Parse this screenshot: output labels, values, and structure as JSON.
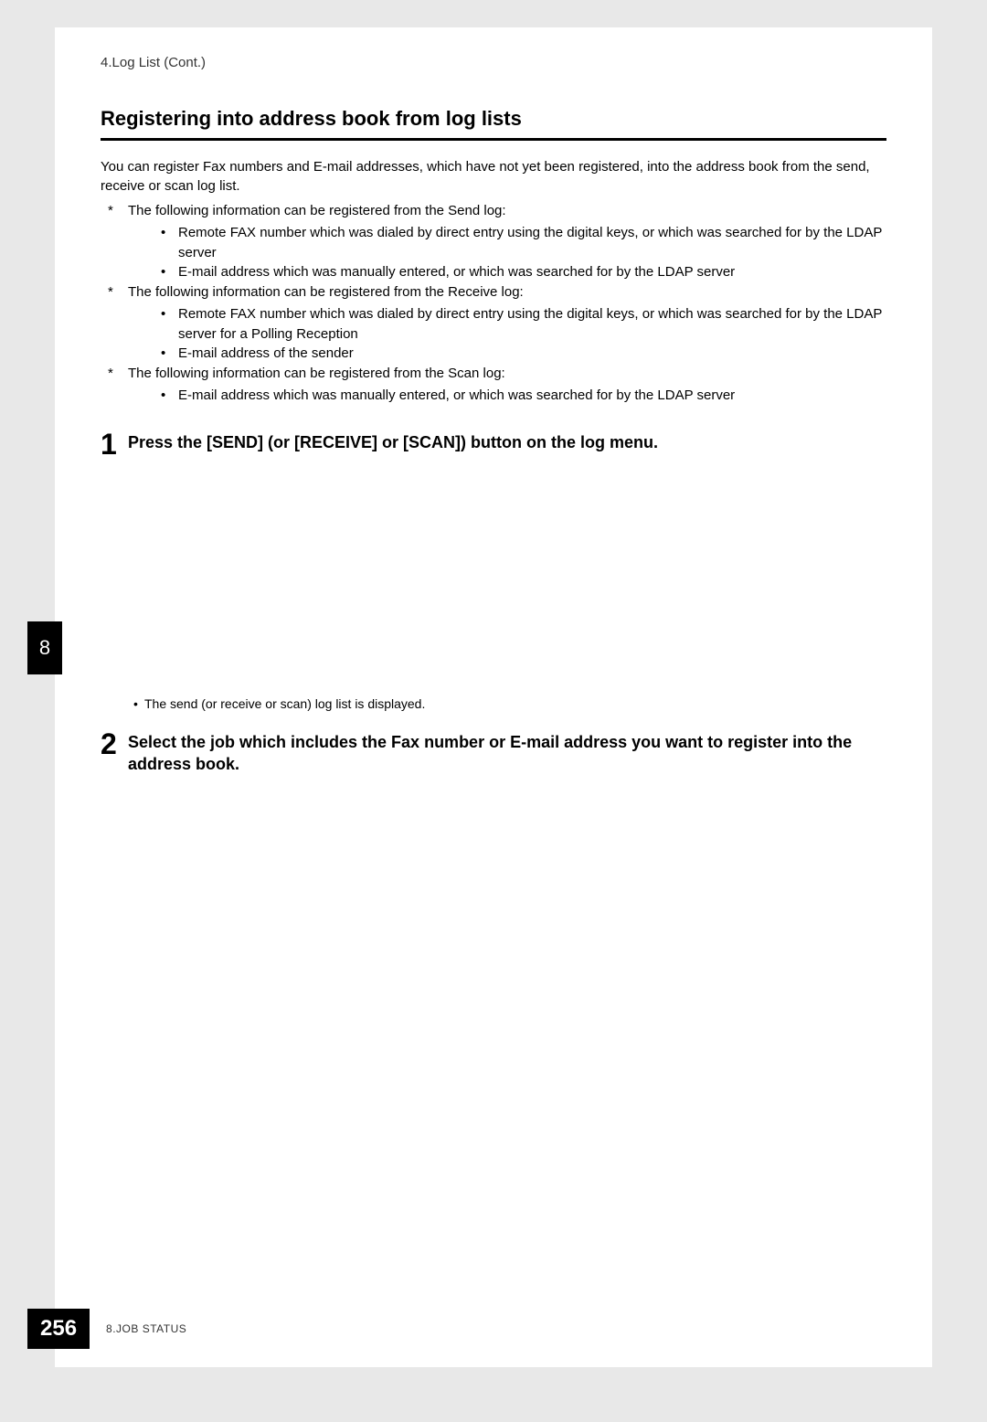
{
  "header": {
    "breadcrumb": "4.Log List (Cont.)"
  },
  "section": {
    "title": "Registering into address book from log lists",
    "intro": "You can register Fax numbers and E-mail addresses, which have not yet been registered, into the address book from the send, receive or scan log list.",
    "groups": [
      {
        "label": "The following information can be registered from the Send log:",
        "items": [
          "Remote FAX number which was dialed by direct entry using the digital keys, or which was searched for by the LDAP server",
          "E-mail address which was manually entered, or which was searched for by the LDAP server"
        ]
      },
      {
        "label": "The following information can be registered from the Receive log:",
        "items": [
          "Remote FAX number which was dialed by direct entry using the digital keys, or which was searched for by the LDAP server for a Polling Reception",
          "E-mail address of the sender"
        ]
      },
      {
        "label": "The following information can be registered from the Scan log:",
        "items": [
          "E-mail address which was manually entered, or which was searched for by the LDAP server"
        ]
      }
    ]
  },
  "steps": {
    "step1": {
      "number": "1",
      "text": "Press the [SEND] (or [RECEIVE] or [SCAN]) button on the log menu.",
      "note": "The send (or receive or scan) log list is displayed."
    },
    "step2": {
      "number": "2",
      "text": "Select the job which includes the Fax number or E-mail address you want to register into the address book."
    }
  },
  "chapter_tab": "8",
  "footer": {
    "page_number": "256",
    "chapter_label": "8.JOB STATUS"
  }
}
